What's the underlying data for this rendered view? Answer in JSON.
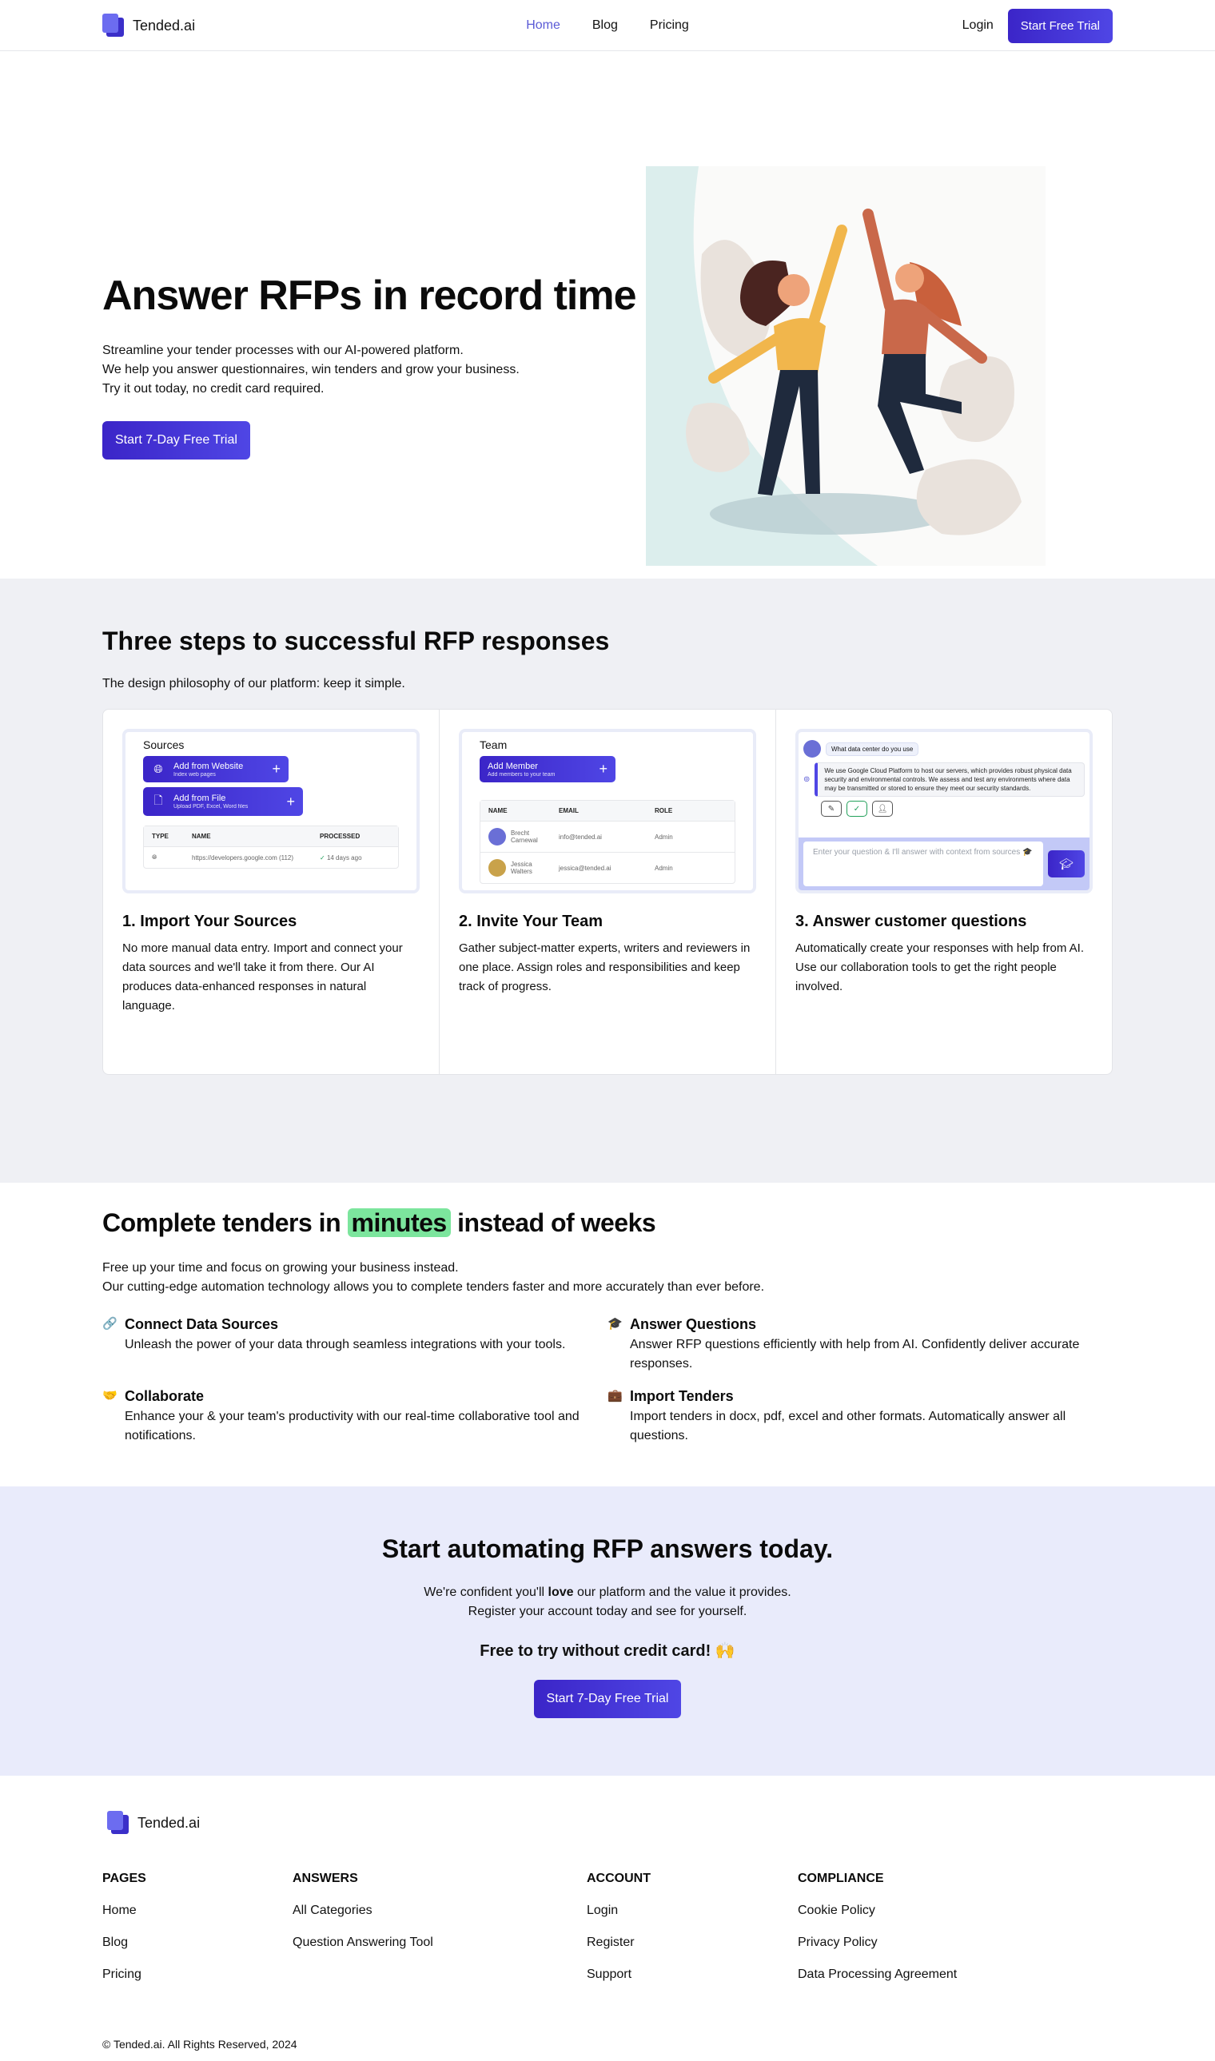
{
  "brand": {
    "name": "Tended.ai",
    "accent": "#4f46e5",
    "accent_dark": "#3b25c8",
    "highlight": "#7ce59d"
  },
  "nav": {
    "links": [
      {
        "label": "Home",
        "active": true
      },
      {
        "label": "Blog",
        "active": false
      },
      {
        "label": "Pricing",
        "active": false
      }
    ],
    "login": "Login",
    "cta": "Start Free Trial"
  },
  "hero": {
    "title": "Answer RFPs in record time",
    "lines": [
      "Streamline your tender processes with our AI-powered platform.",
      "We help you answer questionnaires, win tenders and grow your business.",
      "Try it out today, no credit card required."
    ],
    "cta": "Start 7-Day Free Trial",
    "illustration": "two women jumping and high-fiving"
  },
  "steps": {
    "title": "Three steps to successful RFP responses",
    "subtitle": "The design philosophy of our platform: keep it simple.",
    "cards": [
      {
        "title": "1. Import Your Sources",
        "text": "No more manual data entry. Import and connect your data sources and we'll take it from there. Our AI produces data-enhanced responses in natural language.",
        "mock": {
          "heading": "Sources",
          "buttons": [
            {
              "icon": "globe-icon",
              "title": "Add from Website",
              "subtitle": "Index web pages"
            },
            {
              "icon": "file-icon",
              "title": "Add from File",
              "subtitle": "Upload PDF, Excel, Word files"
            }
          ],
          "columns": [
            "TYPE",
            "NAME",
            "PROCESSED"
          ],
          "rows": [
            {
              "type": "globe",
              "name": "https://developers.google.com (112)",
              "processed": "14 days ago"
            }
          ]
        }
      },
      {
        "title": "2. Invite Your Team",
        "text": "Gather subject-matter experts, writers and reviewers in one place. Assign roles and responsibilities and keep track of progress.",
        "mock": {
          "heading": "Team",
          "button": {
            "title": "Add Member",
            "subtitle": "Add members to your team"
          },
          "columns": [
            "NAME",
            "EMAIL",
            "ROLE"
          ],
          "rows": [
            {
              "name": "Brecht Carnewal",
              "email": "info@tended.ai",
              "role": "Admin"
            },
            {
              "name": "Jessica Walters",
              "email": "jessica@tended.ai",
              "role": "Admin"
            }
          ]
        }
      },
      {
        "title": "3. Answer customer questions",
        "text": "Automatically create your responses with help from AI. Use our collaboration tools to get the right people involved.",
        "mock": {
          "question": "What data center do you use",
          "answer": "We use Google Cloud Platform to host our servers, which provides robust physical data security and environmental controls. We assess and test any environments where data may be transmitted or stored to ensure they meet our security standards.",
          "input_placeholder": "Enter your question & I'll answer with context from sources 🎓"
        }
      }
    ]
  },
  "features": {
    "title_before": "Complete tenders in ",
    "title_highlight": "minutes",
    "title_after": " instead of weeks",
    "lines": [
      "Free up your time and focus on growing your business instead.",
      "Our cutting-edge automation technology allows you to complete tenders faster and more accurately than ever before."
    ],
    "items": [
      {
        "icon": "🔗",
        "title": "Connect Data Sources",
        "text": "Unleash the power of your data through seamless integrations with your tools."
      },
      {
        "icon": "🎓",
        "title": "Answer Questions",
        "text": "Answer RFP questions efficiently with help from AI. Confidently deliver accurate responses."
      },
      {
        "icon": "🤝",
        "title": "Collaborate",
        "text": "Enhance your & your team's productivity with our real-time collaborative tool and notifications."
      },
      {
        "icon": "💼",
        "title": "Import Tenders",
        "text": "Import tenders in docx, pdf, excel and other formats. Automatically answer all questions."
      }
    ]
  },
  "cta": {
    "title": "Start automating RFP answers today.",
    "line1_before": "We're confident you'll ",
    "line1_bold": "love",
    "line1_after": " our platform and the value it provides.",
    "line2": "Register your account today and see for yourself.",
    "free": "Free to try without credit card! 🙌",
    "button": "Start 7-Day Free Trial"
  },
  "footer": {
    "columns": [
      {
        "heading": "PAGES",
        "links": [
          "Home",
          "Blog",
          "Pricing"
        ]
      },
      {
        "heading": "ANSWERS",
        "links": [
          "All Categories",
          "Question Answering Tool"
        ]
      },
      {
        "heading": "ACCOUNT",
        "links": [
          "Login",
          "Register",
          "Support"
        ]
      },
      {
        "heading": "COMPLIANCE",
        "links": [
          "Cookie Policy",
          "Privacy Policy",
          "Data Processing Agreement"
        ]
      }
    ],
    "copyright": "© Tended.ai. All Rights Reserved, 2024"
  }
}
